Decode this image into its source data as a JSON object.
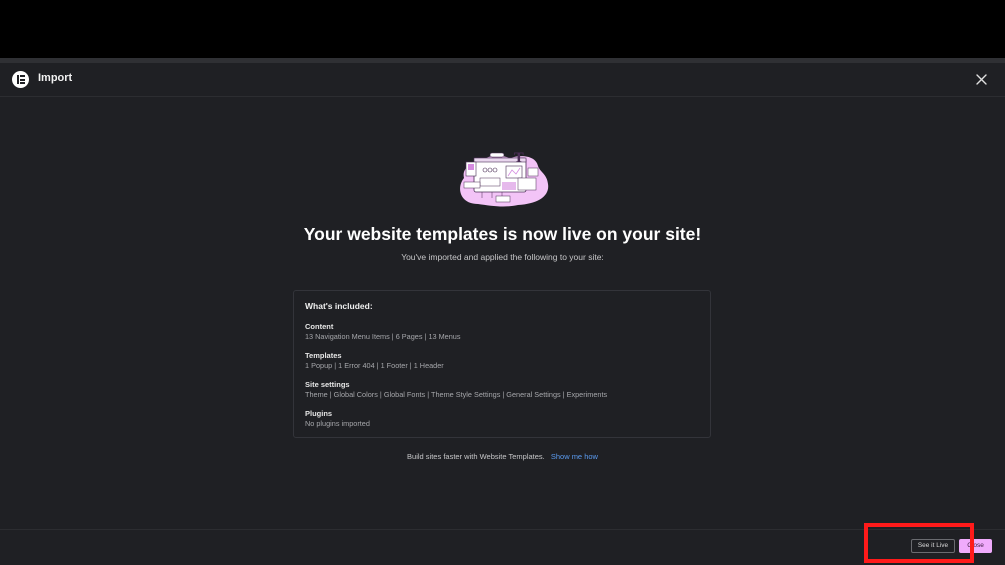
{
  "header": {
    "title": "Import"
  },
  "main": {
    "headline": "Your website templates is now live on your site!",
    "subline": "You've imported and applied the following to your site:"
  },
  "card": {
    "title": "What's included:",
    "sections": [
      {
        "title": "Content",
        "text": "13 Navigation Menu Items | 6 Pages | 13 Menus"
      },
      {
        "title": "Templates",
        "text": "1 Popup | 1 Error 404 | 1 Footer | 1 Header"
      },
      {
        "title": "Site settings",
        "text": "Theme | Global Colors | Global Fonts | Theme Style Settings | General Settings | Experiments"
      },
      {
        "title": "Plugins",
        "text": "No plugins imported"
      }
    ]
  },
  "footnote": {
    "text": "Build sites faster with Website Templates.",
    "link": "Show me how"
  },
  "footer": {
    "see_live_label": "See it Live",
    "close_label": "Close"
  },
  "colors": {
    "accent": "#f0abfc",
    "link": "#5b9bf0",
    "background": "#1f2024",
    "highlight": "#ff1a1a"
  },
  "icons": {
    "logo": "elementor-logo-icon",
    "close": "close-icon",
    "illustration": "website-templates-illustration"
  }
}
